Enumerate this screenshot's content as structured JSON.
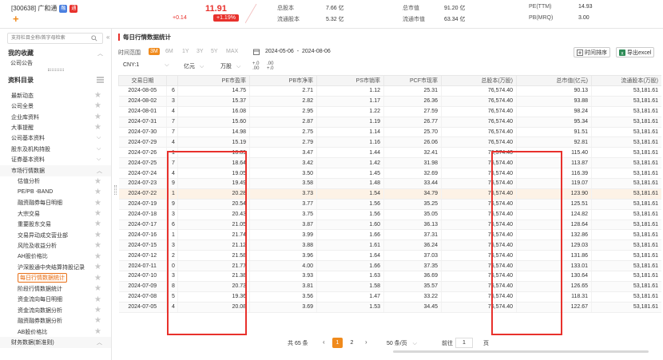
{
  "header": {
    "stock_name": "[300638] 广和通",
    "badge_rong": "融",
    "badge_tong": "通",
    "price": "11.91",
    "change": "+0.14",
    "change_pct": "+1.19%",
    "stats": [
      {
        "label": "总股本",
        "value": "7.66 亿"
      },
      {
        "label": "流通股本",
        "value": "5.32 亿"
      },
      {
        "label": "总市值",
        "value": "91.20 亿"
      },
      {
        "label": "流通市值",
        "value": "63.34 亿"
      },
      {
        "label": "PE(TTM)",
        "value": "14.93"
      },
      {
        "label": "PB(MRQ)",
        "value": "3.00"
      }
    ],
    "colors": {
      "up": "#e8312c",
      "accent": "#f08a1c"
    }
  },
  "sidebar": {
    "search_placeholder": "支持栏目全称/首字母检索",
    "favorites_title": "我的收藏",
    "favorites": [
      "公司公告"
    ],
    "catalog_title": "资料目录",
    "items": [
      {
        "label": "最新动态",
        "indent": 0,
        "type": "leaf"
      },
      {
        "label": "公司全景",
        "indent": 0,
        "type": "leaf"
      },
      {
        "label": "企业库资料",
        "indent": 0,
        "type": "leaf"
      },
      {
        "label": "大事提醒",
        "indent": 0,
        "type": "leaf"
      },
      {
        "label": "公司基本资料",
        "indent": 0,
        "type": "group"
      },
      {
        "label": "股东及机构持股",
        "indent": 0,
        "type": "group"
      },
      {
        "label": "证券基本资料",
        "indent": 0,
        "type": "group"
      },
      {
        "label": "市场行情数据",
        "indent": 0,
        "type": "group-open"
      },
      {
        "label": "估值分析",
        "indent": 1,
        "type": "leaf"
      },
      {
        "label": "PE/PB -BAND",
        "indent": 1,
        "type": "leaf"
      },
      {
        "label": "融资融券每日明细",
        "indent": 1,
        "type": "leaf"
      },
      {
        "label": "大宗交易",
        "indent": 1,
        "type": "leaf"
      },
      {
        "label": "重要股东交易",
        "indent": 1,
        "type": "leaf"
      },
      {
        "label": "交易异动成交营业部",
        "indent": 1,
        "type": "leaf"
      },
      {
        "label": "风险及收益分析",
        "indent": 1,
        "type": "leaf"
      },
      {
        "label": "AH股价格比",
        "indent": 1,
        "type": "leaf"
      },
      {
        "label": "沪深股通中央结算持股记录",
        "indent": 1,
        "type": "leaf"
      },
      {
        "label": "每日行情数据统计",
        "indent": 1,
        "type": "active"
      },
      {
        "label": "阶段行情数据统计",
        "indent": 1,
        "type": "leaf"
      },
      {
        "label": "资金流向每日明细",
        "indent": 1,
        "type": "leaf"
      },
      {
        "label": "资金流向数据分析",
        "indent": 1,
        "type": "leaf"
      },
      {
        "label": "融资融券数据分析",
        "indent": 1,
        "type": "leaf"
      },
      {
        "label": "AB股价格比",
        "indent": 1,
        "type": "leaf"
      },
      {
        "label": "财务数据(新准则)",
        "indent": 0,
        "type": "group-open"
      }
    ]
  },
  "main": {
    "title": "每日行情数据统计",
    "range_label": "时间范围",
    "ranges": [
      "3M",
      "6M",
      "1Y",
      "3Y",
      "5Y",
      "MAX"
    ],
    "selected_range": "3M",
    "date_start": "2024-05-06",
    "date_sep": "-",
    "date_end": "2024-08-06",
    "sort_button": "时间排序",
    "export_button": "导出excel",
    "currency": "CNY:1",
    "unit_value": "亿元",
    "unit_shares": "万股",
    "dec_plus": "+.0",
    "dec_plus2": ".00",
    "dec_minus": ".00",
    "dec_minus2": "+.0",
    "columns": [
      "交易日期",
      "",
      "PE市盈率",
      "PB市净率",
      "PS市销率",
      "PCF市现率",
      "总股本(万股)",
      "总市值(亿元)",
      "流通股本(万股)"
    ],
    "rows": [
      [
        "2024-08-05",
        "6",
        "14.75",
        "2.71",
        "1.12",
        "25.31",
        "76,574.40",
        "90.13",
        "53,181.61"
      ],
      [
        "2024-08-02",
        "3",
        "15.37",
        "2.82",
        "1.17",
        "26.36",
        "76,574.40",
        "93.88",
        "53,181.61"
      ],
      [
        "2024-08-01",
        "4",
        "16.08",
        "2.95",
        "1.22",
        "27.59",
        "76,574.40",
        "98.24",
        "53,181.61"
      ],
      [
        "2024-07-31",
        "7",
        "15.60",
        "2.87",
        "1.19",
        "26.77",
        "76,574.40",
        "95.34",
        "53,181.61"
      ],
      [
        "2024-07-30",
        "7",
        "14.98",
        "2.75",
        "1.14",
        "25.70",
        "76,574.40",
        "91.51",
        "53,181.61"
      ],
      [
        "2024-07-29",
        "4",
        "15.19",
        "2.79",
        "1.16",
        "26.06",
        "76,574.40",
        "92.81",
        "53,181.61"
      ],
      [
        "2024-07-26",
        "1",
        "18.89",
        "3.47",
        "1.44",
        "32.41",
        "76,574.40",
        "115.40",
        "53,181.61"
      ],
      [
        "2024-07-25",
        "7",
        "18.64",
        "3.42",
        "1.42",
        "31.98",
        "76,574.40",
        "113.87",
        "53,181.61"
      ],
      [
        "2024-07-24",
        "4",
        "19.05",
        "3.50",
        "1.45",
        "32.69",
        "76,574.40",
        "116.39",
        "53,181.61"
      ],
      [
        "2024-07-23",
        "9",
        "19.49",
        "3.58",
        "1.48",
        "33.44",
        "76,574.40",
        "119.07",
        "53,181.61"
      ],
      [
        "2024-07-22",
        "1",
        "20.28",
        "3.73",
        "1.54",
        "34.79",
        "76,574.40",
        "123.90",
        "53,181.61"
      ],
      [
        "2024-07-19",
        "9",
        "20.54",
        "3.77",
        "1.56",
        "35.25",
        "76,574.40",
        "125.51",
        "53,181.61"
      ],
      [
        "2024-07-18",
        "3",
        "20.43",
        "3.75",
        "1.56",
        "35.05",
        "76,574.40",
        "124.82",
        "53,181.61"
      ],
      [
        "2024-07-17",
        "6",
        "21.05",
        "3.87",
        "1.60",
        "36.13",
        "76,574.40",
        "128.64",
        "53,181.61"
      ],
      [
        "2024-07-16",
        "1",
        "21.74",
        "3.99",
        "1.66",
        "37.31",
        "76,574.40",
        "132.86",
        "53,181.61"
      ],
      [
        "2024-07-15",
        "3",
        "21.12",
        "3.88",
        "1.61",
        "36.24",
        "76,574.40",
        "129.03",
        "53,181.61"
      ],
      [
        "2024-07-12",
        "2",
        "21.58",
        "3.96",
        "1.64",
        "37.03",
        "76,574.40",
        "131.86",
        "53,181.61"
      ],
      [
        "2024-07-11",
        "0",
        "21.77",
        "4.00",
        "1.66",
        "37.35",
        "76,574.40",
        "133.01",
        "53,181.61"
      ],
      [
        "2024-07-10",
        "3",
        "21.38",
        "3.93",
        "1.63",
        "36.69",
        "76,574.40",
        "130.64",
        "53,181.61"
      ],
      [
        "2024-07-09",
        "8",
        "20.73",
        "3.81",
        "1.58",
        "35.57",
        "76,574.40",
        "126.65",
        "53,181.61"
      ],
      [
        "2024-07-08",
        "5",
        "19.36",
        "3.56",
        "1.47",
        "33.22",
        "76,574.40",
        "118.31",
        "53,181.61"
      ],
      [
        "2024-07-05",
        "4",
        "20.08",
        "3.69",
        "1.53",
        "34.45",
        "76,574.40",
        "122.67",
        "53,181.61"
      ]
    ],
    "highlight_row": 10,
    "pager": {
      "total": "共 65 条",
      "pages": [
        "1",
        "2"
      ],
      "current": "1",
      "size": "50 条/页",
      "goto_label": "前往",
      "goto_value": "1",
      "page_label": "页"
    }
  }
}
